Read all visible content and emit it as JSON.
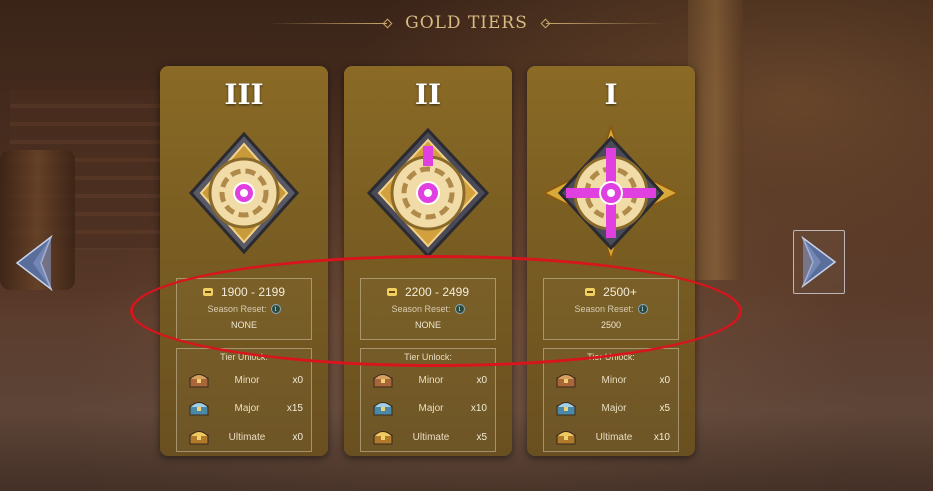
{
  "header": {
    "title": "GOLD TIERS"
  },
  "nav": {
    "prev_icon": "chevron-left-icon",
    "next_icon": "chevron-right-icon"
  },
  "colors": {
    "card": "#7a5e22",
    "header_gold": "#d9bb84",
    "highlight": "#d8141c",
    "emblem_gem": "#e040e0"
  },
  "tiers": [
    {
      "numeral": "III",
      "range": "1900 - 2199",
      "reset_label": "Season Reset:",
      "reset_value": "NONE",
      "unlock_title": "Tier Unlock:",
      "rewards": [
        {
          "label": "Minor",
          "count": "x0"
        },
        {
          "label": "Major",
          "count": "x15"
        },
        {
          "label": "Ultimate",
          "count": "x0"
        }
      ]
    },
    {
      "numeral": "II",
      "range": "2200 - 2499",
      "reset_label": "Season Reset:",
      "reset_value": "NONE",
      "unlock_title": "Tier Unlock:",
      "rewards": [
        {
          "label": "Minor",
          "count": "x0"
        },
        {
          "label": "Major",
          "count": "x10"
        },
        {
          "label": "Ultimate",
          "count": "x5"
        }
      ]
    },
    {
      "numeral": "I",
      "range": "2500+",
      "reset_label": "Season Reset:",
      "reset_value": "2500",
      "unlock_title": "Tier Unlock:",
      "rewards": [
        {
          "label": "Minor",
          "count": "x0"
        },
        {
          "label": "Major",
          "count": "x5"
        },
        {
          "label": "Ultimate",
          "count": "x10"
        }
      ]
    }
  ]
}
